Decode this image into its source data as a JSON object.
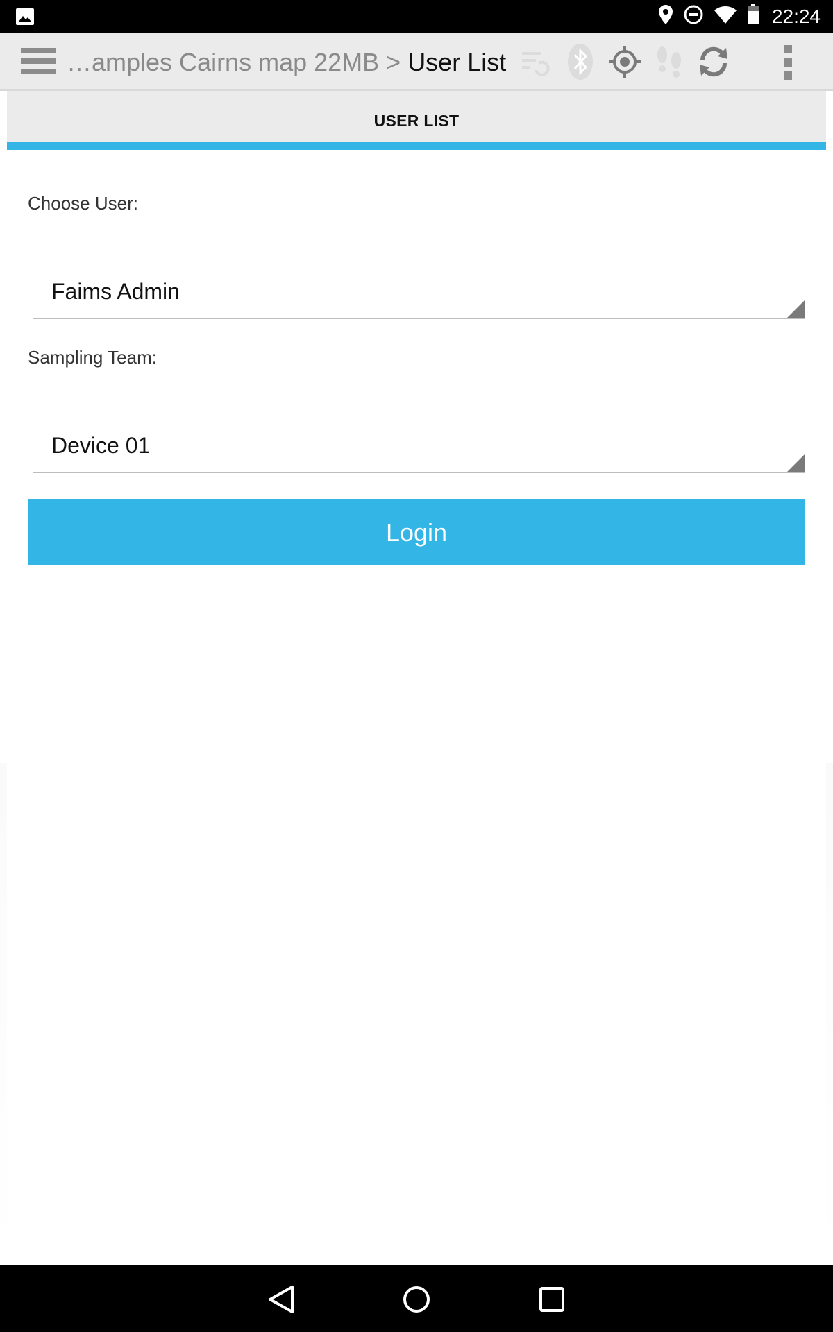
{
  "status_bar": {
    "time": "22:24",
    "icons": [
      "gallery-icon",
      "location-pin-icon",
      "do-not-disturb-icon",
      "wifi-icon",
      "battery-icon"
    ]
  },
  "action_bar": {
    "breadcrumb_path": "…amples Cairns map 22MB > ",
    "breadcrumb_current": "User List",
    "icons": [
      "hamburger-menu-icon",
      "sync-files-icon",
      "bluetooth-icon",
      "gps-target-icon",
      "footprints-icon",
      "refresh-icon",
      "overflow-menu-icon"
    ]
  },
  "tab": {
    "label": "USER LIST",
    "accent_color": "#33b5e5"
  },
  "form": {
    "choose_user_label": "Choose User:",
    "choose_user_value": "Faims Admin",
    "sampling_team_label": "Sampling Team:",
    "sampling_team_value": "Device 01",
    "login_label": "Login"
  },
  "nav_bar": {
    "icons": [
      "back-icon",
      "home-icon",
      "recents-icon"
    ]
  }
}
